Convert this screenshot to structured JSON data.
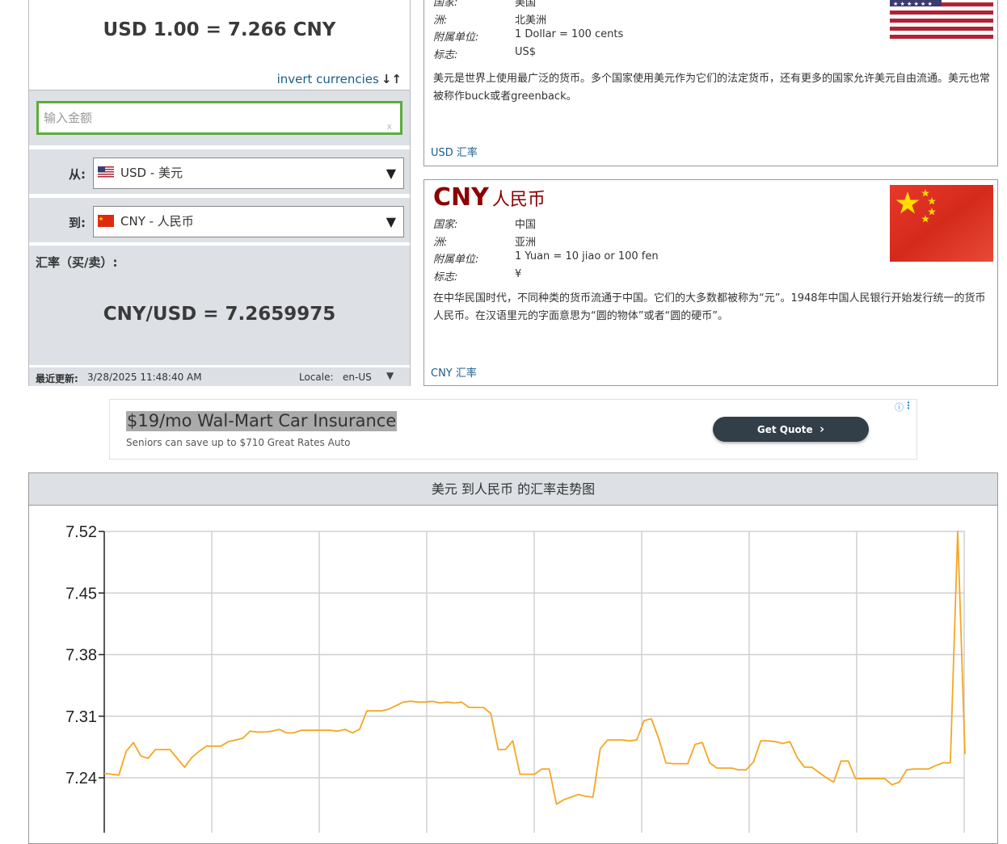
{
  "converter": {
    "result": "USD 1.00 = 7.266 CNY",
    "invert_label": "invert currencies",
    "invert_icon": "↓↑",
    "amount_placeholder": "输入金额",
    "amount_clear": "x",
    "from_label": "从:",
    "from_value": "USD - 美元",
    "to_label": "到:",
    "to_value": "CNY - 人民币",
    "rate_title": "汇率（买/卖）:",
    "rate_value": "CNY/USD = 7.2659975",
    "updated_label": "最近更新:",
    "updated_value": "3/28/2025 11:48:40 AM",
    "locale_label": "Locale:",
    "locale_value": "en-US",
    "caret": "▼"
  },
  "usd_card": {
    "rows": [
      {
        "key": "国家:",
        "value": "美国"
      },
      {
        "key": "洲:",
        "value": "北美洲"
      },
      {
        "key": "附属单位:",
        "value": "1 Dollar = 100 cents"
      },
      {
        "key": "标志:",
        "value": "US$"
      }
    ],
    "description": "美元是世界上使用最广泛的货币。多个国家使用美元作为它们的法定货币，还有更多的国家允许美元自由流通。美元也常被称作buck或者greenback。",
    "link": "USD 汇率",
    "flag_icon": "us-flag-icon"
  },
  "cny_card": {
    "code": "CNY",
    "name": "人民币",
    "rows": [
      {
        "key": "国家:",
        "value": "中国"
      },
      {
        "key": "洲:",
        "value": "亚洲"
      },
      {
        "key": "附属单位:",
        "value": "1 Yuan = 10 jiao or 100 fen"
      },
      {
        "key": "标志:",
        "value": "¥"
      }
    ],
    "description": "在中华民国时代，不同种类的货币流通于中国。它们的大多数都被称为“元”。1948年中国人民银行开始发行统一的货币人民币。在汉语里元的字面意思为“圆的物体”或者“圆的硬币”。",
    "link": "CNY 汇率",
    "flag_icon": "cn-flag-icon"
  },
  "ad": {
    "title": "$19/mo Wal-Mart Car Insurance",
    "subtitle": "Seniors can save up to $710 Great Rates Auto",
    "button": "Get Quote",
    "button_icon": "›",
    "info_icon": "ⓘ",
    "menu_icon": "⋮"
  },
  "chart_header": "美元 到人民币 的汇率走势图",
  "colors": {
    "line": "#f5a623",
    "panel_bg": "#dde1e6",
    "accent_green": "#5cad3a",
    "brand_red": "#8b0000",
    "link_blue": "#1a5e8c"
  },
  "chart_data": {
    "type": "line",
    "title": "",
    "xlabel": "",
    "ylabel": "",
    "y_ticks": [
      7.24,
      7.31,
      7.38,
      7.45,
      7.52
    ],
    "ylim": [
      7.2,
      7.52
    ],
    "grid": true,
    "series": [
      {
        "values": [
          7.245,
          7.244,
          7.243,
          7.27,
          7.28,
          7.265,
          7.262,
          7.272,
          7.272,
          7.272,
          7.262,
          7.252,
          7.263,
          7.27,
          7.276,
          7.276,
          7.276,
          7.281,
          7.283,
          7.285,
          7.293,
          7.292,
          7.292,
          7.293,
          7.295,
          7.291,
          7.291,
          7.294,
          7.294,
          7.294,
          7.294,
          7.294,
          7.293,
          7.295,
          7.291,
          7.295,
          7.316,
          7.316,
          7.316,
          7.318,
          7.322,
          7.326,
          7.327,
          7.326,
          7.326,
          7.327,
          7.325,
          7.326,
          7.325,
          7.326,
          7.32,
          7.32,
          7.32,
          7.313,
          7.272,
          7.272,
          7.282,
          7.244,
          7.244,
          7.244,
          7.25,
          7.25,
          7.21,
          7.215,
          7.218,
          7.221,
          7.219,
          7.218,
          7.273,
          7.283,
          7.283,
          7.283,
          7.282,
          7.283,
          7.305,
          7.307,
          7.285,
          7.257,
          7.256,
          7.256,
          7.256,
          7.278,
          7.28,
          7.257,
          7.251,
          7.251,
          7.251,
          7.249,
          7.249,
          7.258,
          7.282,
          7.282,
          7.281,
          7.279,
          7.281,
          7.263,
          7.252,
          7.252,
          7.246,
          7.24,
          7.235,
          7.259,
          7.259,
          7.239,
          7.239,
          7.239,
          7.239,
          7.239,
          7.232,
          7.235,
          7.249,
          7.25,
          7.25,
          7.25,
          7.254,
          7.257,
          7.257,
          7.52,
          7.267
        ]
      }
    ]
  }
}
